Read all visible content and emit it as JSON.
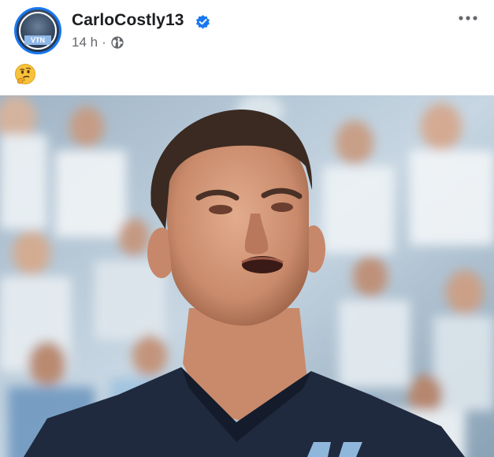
{
  "post": {
    "author": "CarloCostly13",
    "verified": true,
    "timestamp": "14 h",
    "separator": "·",
    "audience_icon": "globe-icon",
    "more_icon": "more-options-icon",
    "caption_emoji": "🤔",
    "avatar_text": "VTN"
  },
  "photo": {
    "description_icon": "photo-of-player"
  },
  "colors": {
    "accent": "#1877f2",
    "text_primary": "#1c1e21",
    "text_secondary": "#65676b"
  }
}
